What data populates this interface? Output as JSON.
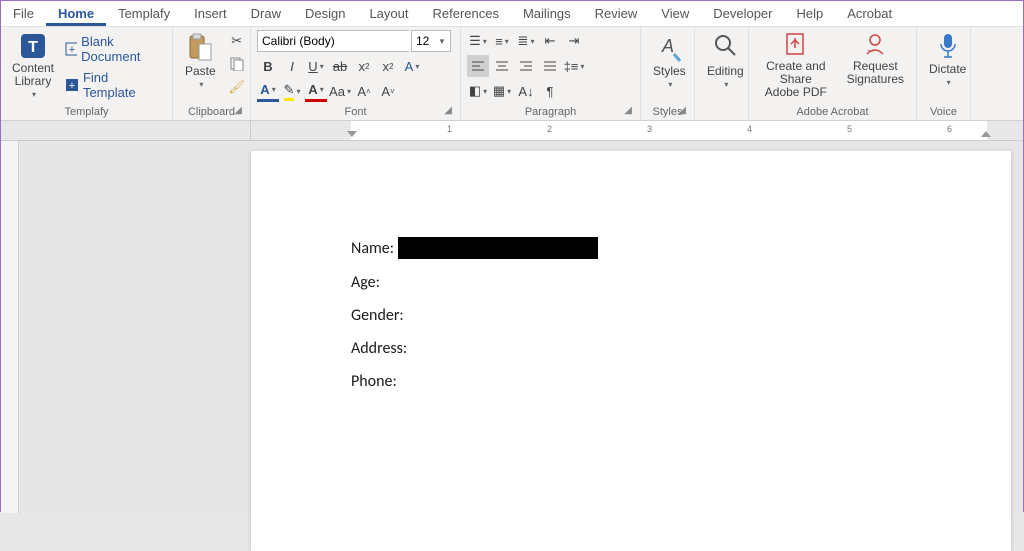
{
  "tabs": {
    "file": "File",
    "home": "Home",
    "templafy": "Templafy",
    "insert": "Insert",
    "draw": "Draw",
    "design": "Design",
    "layout": "Layout",
    "references": "References",
    "mailings": "Mailings",
    "review": "Review",
    "view": "View",
    "developer": "Developer",
    "help": "Help",
    "acrobat": "Acrobat"
  },
  "templafy": {
    "content_library": "Content\nLibrary",
    "blank_document": "Blank Document",
    "find_template": "Find Template",
    "group": "Templafy"
  },
  "clipboard": {
    "paste": "Paste",
    "group": "Clipboard"
  },
  "font": {
    "name": "Calibri (Body)",
    "size": "12",
    "group": "Font"
  },
  "paragraph": {
    "group": "Paragraph"
  },
  "styles": {
    "label": "Styles",
    "group": "Styles"
  },
  "editing": {
    "label": "Editing"
  },
  "acrobat_group": {
    "create_share": "Create and Share\nAdobe PDF",
    "request_sig": "Request\nSignatures",
    "group": "Adobe Acrobat"
  },
  "voice": {
    "dictate": "Dictate",
    "group": "Voice"
  },
  "document": {
    "name_label": "Name:",
    "age_label": "Age:",
    "gender_label": "Gender:",
    "address_label": "Address:",
    "phone_label": "Phone:"
  },
  "ruler_numbers": [
    "1",
    "2",
    "3",
    "4",
    "5",
    "6"
  ]
}
